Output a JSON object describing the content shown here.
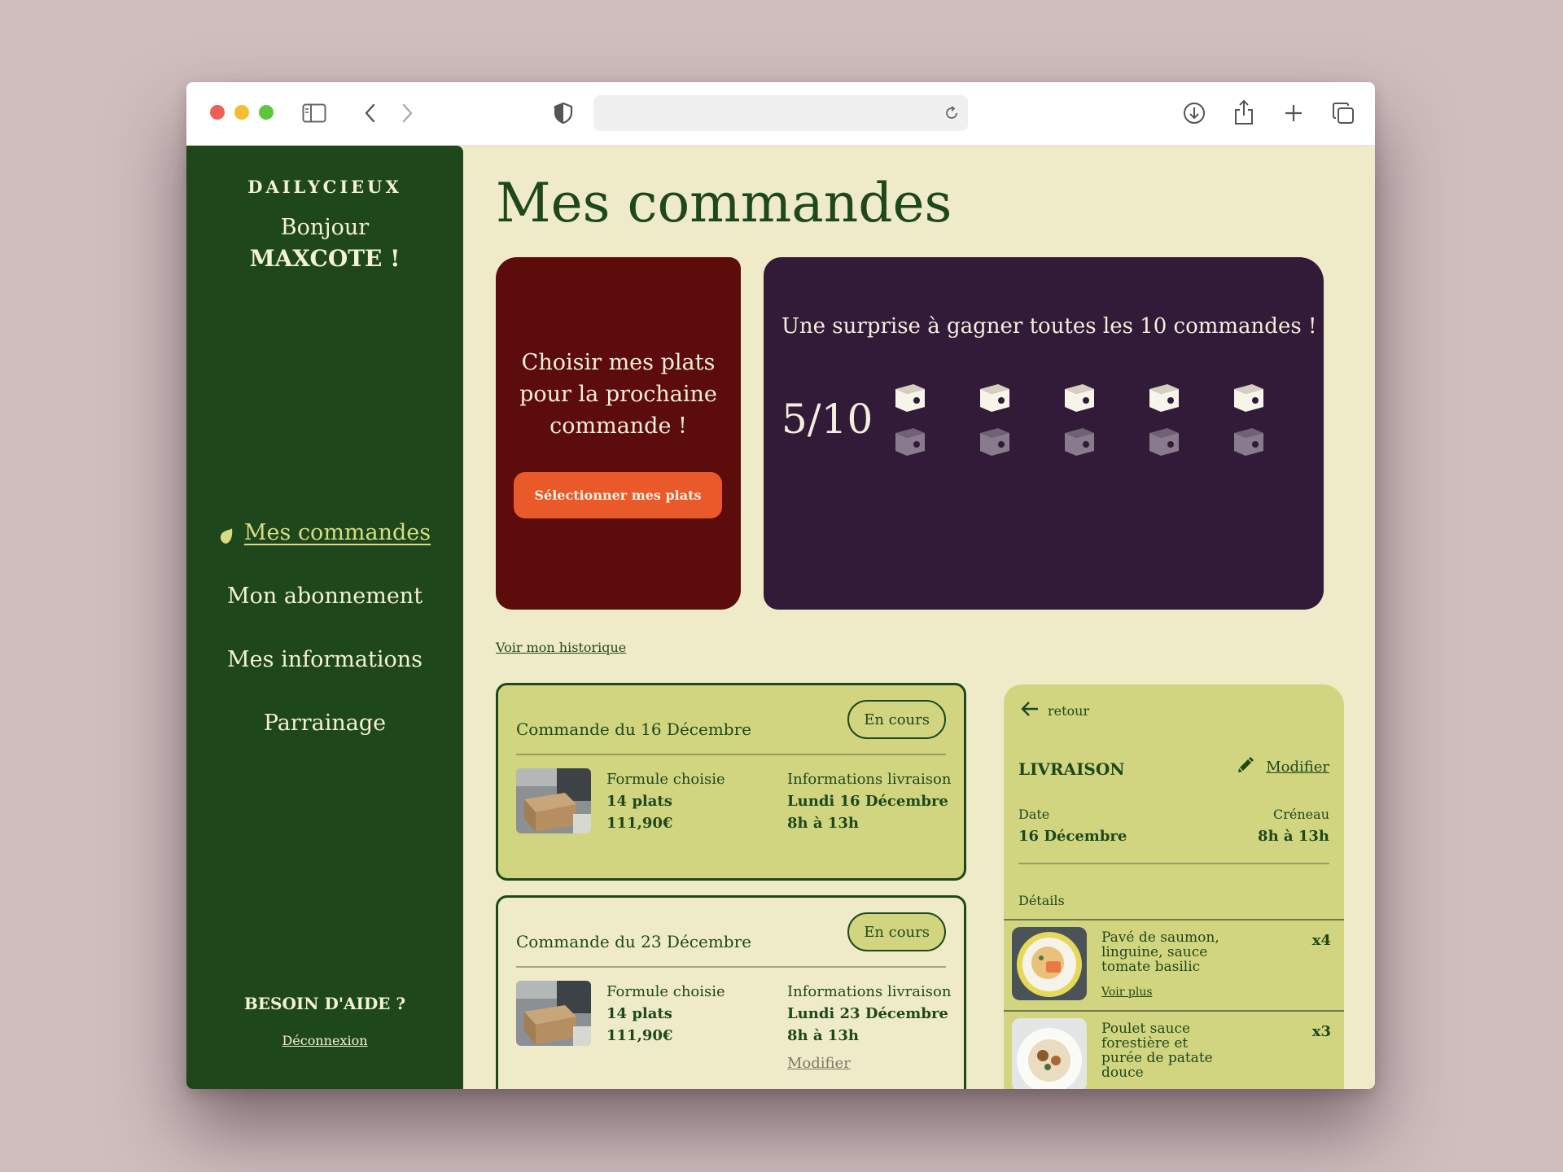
{
  "browser": {
    "url": ""
  },
  "sidebar": {
    "brand": "DAILYCIEUX",
    "greeting": "Bonjour",
    "username": "MAXCOTE !",
    "nav": [
      {
        "label": "Mes commandes",
        "active": true
      },
      {
        "label": "Mon abonnement",
        "active": false
      },
      {
        "label": "Mes informations",
        "active": false
      },
      {
        "label": "Parrainage",
        "active": false
      }
    ],
    "help": "BESOIN D'AIDE ?",
    "logout": "Déconnexion"
  },
  "main": {
    "title": "Mes commandes",
    "promo": {
      "text": "Choisir mes plats pour la prochaine commande !",
      "button": "Sélectionner mes plats"
    },
    "loyalty": {
      "text": "Une surprise à gagner toutes les 10 commandes !",
      "count": "5/10",
      "completed": 5,
      "total": 10
    },
    "history_link": "Voir mon historique",
    "orders": [
      {
        "title": "Commande du 16 Décembre",
        "status": "En cours",
        "formula_label": "Formule choisie",
        "formula_plats": "14 plats",
        "formula_price": "111,90€",
        "delivery_label": "Informations livraison",
        "delivery_day": "Lundi 16 Décembre",
        "delivery_time": "8h à 13h"
      },
      {
        "title": "Commande du 23 Décembre",
        "status": "En cours",
        "formula_label": "Formule choisie",
        "formula_plats": "14 plats",
        "formula_price": "111,90€",
        "delivery_label": "Informations livraison",
        "delivery_day": "Lundi 23 Décembre",
        "delivery_time": "8h à 13h",
        "modify": "Modifier"
      }
    ]
  },
  "panel": {
    "back": "retour",
    "title": "LIVRAISON",
    "modify": "Modifier",
    "date_label": "Date",
    "date_value": "16 Décembre",
    "slot_label": "Créneau",
    "slot_value": "8h à 13h",
    "details_label": "Détails",
    "items": [
      {
        "name": "Pavé de saumon, linguine, sauce tomate basilic",
        "qty": "x4",
        "more": "Voir plus"
      },
      {
        "name": "Poulet sauce forestière et purée de patate douce",
        "qty": "x3"
      }
    ]
  },
  "colors": {
    "sidebar": "#1e481b",
    "background": "#efebc8",
    "promo_card": "#5c0c0b",
    "loyalty_card": "#311b38",
    "accent_button": "#e9592a",
    "order_card": "#d2d580"
  }
}
